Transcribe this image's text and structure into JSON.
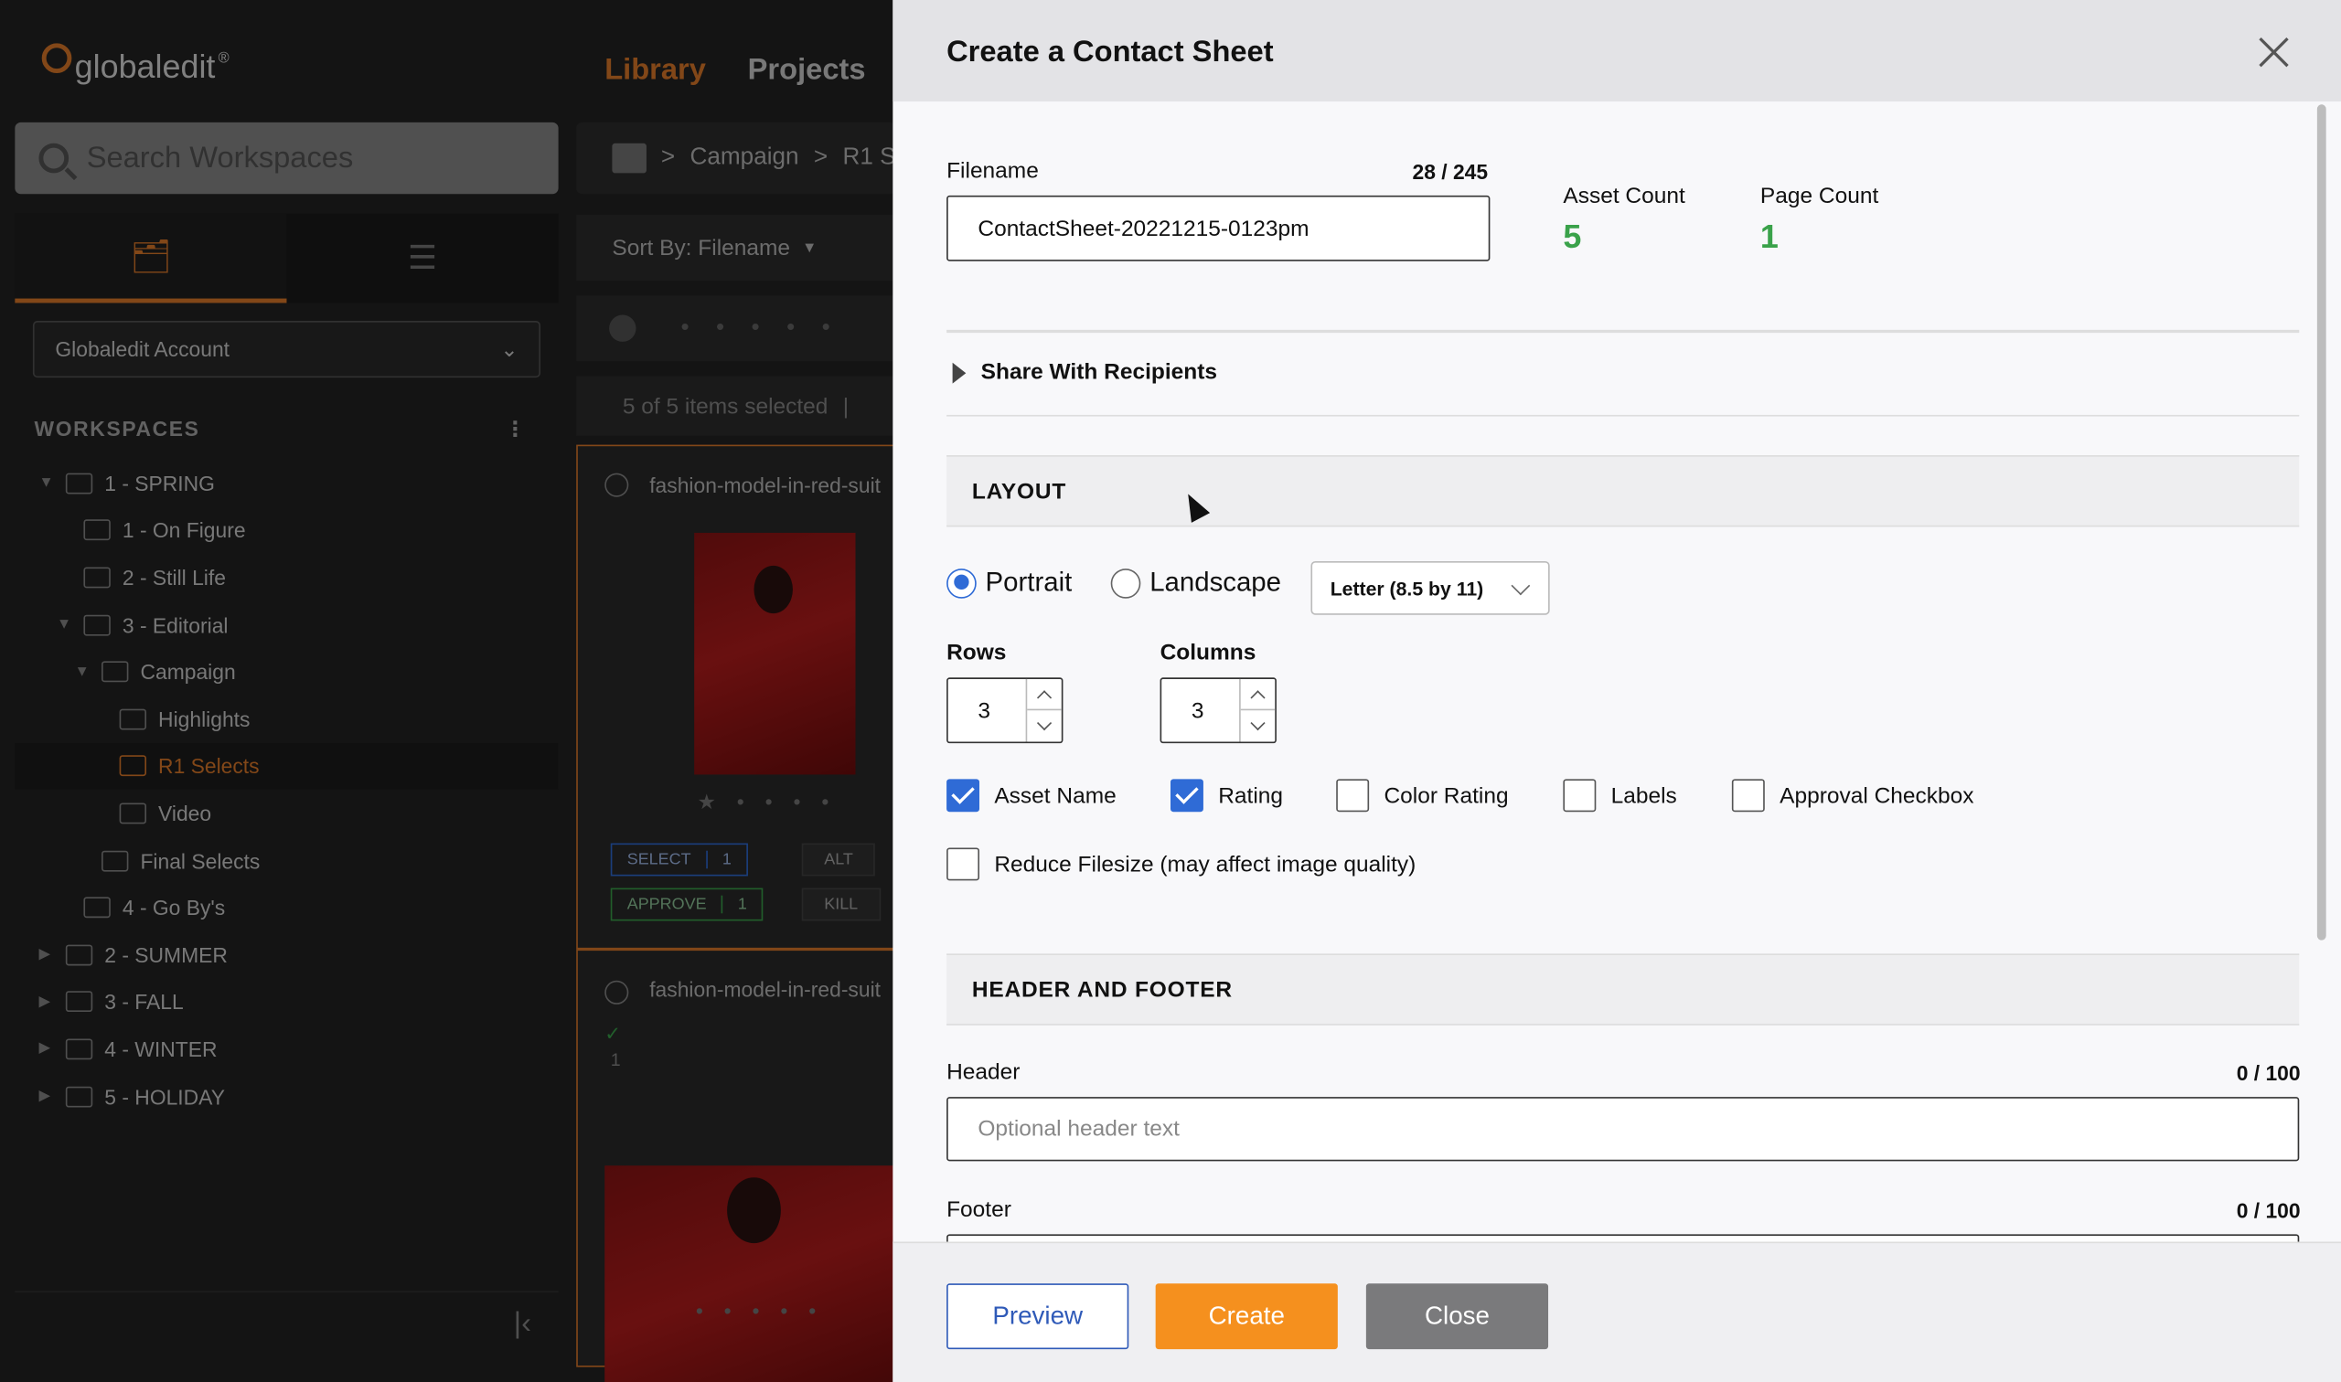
{
  "app": {
    "brand": "globaledit",
    "brand_mark": "®",
    "nav": {
      "library": "Library",
      "projects": "Projects"
    },
    "search_placeholder": "Search Workspaces",
    "account": "Globaledit Account",
    "workspaces_heading": "WORKSPACES",
    "tree": [
      {
        "label": "1 - SPRING",
        "level": 0,
        "expanded": true
      },
      {
        "label": "1 - On Figure",
        "level": 1
      },
      {
        "label": "2 - Still Life",
        "level": 1
      },
      {
        "label": "3 - Editorial",
        "level": 1,
        "expanded": true
      },
      {
        "label": "Campaign",
        "level": 2,
        "expanded": true
      },
      {
        "label": "Highlights",
        "level": 3
      },
      {
        "label": "R1 Selects",
        "level": 3,
        "selected": true
      },
      {
        "label": "Video",
        "level": 3
      },
      {
        "label": "Final Selects",
        "level": 2
      },
      {
        "label": "4 - Go By's",
        "level": 1
      },
      {
        "label": "2 - SUMMER",
        "level": 0
      },
      {
        "label": "3 - FALL",
        "level": 0
      },
      {
        "label": "4 - WINTER",
        "level": 0
      },
      {
        "label": "5 - HOLIDAY",
        "level": 0
      }
    ],
    "breadcrumb": {
      "sep": ">",
      "campaign": "Campaign",
      "current": "R1 S"
    },
    "sort_label": "Sort By: Filename",
    "selection_text": "5 of 5 items selected",
    "assets": [
      {
        "name": "fashion-model-in-red-suit"
      },
      {
        "name": "fashion-model-in-red-suit"
      }
    ],
    "asset_actions": {
      "select": "SELECT",
      "select_count": "1",
      "alt": "ALT",
      "approve": "APPROVE",
      "approve_count": "1",
      "kill": "KILL"
    },
    "asset2_badge": "1",
    "colors": {
      "accent": "#e07a2a",
      "selected_green": "#3aa24a"
    }
  },
  "modal": {
    "title": "Create a Contact Sheet",
    "filename_label": "Filename",
    "filename_counter": "28 / 245",
    "filename_value": "ContactSheet-20221215-0123pm",
    "asset_count_label": "Asset Count",
    "asset_count": "5",
    "page_count_label": "Page Count",
    "page_count": "1",
    "share_label": "Share With Recipients",
    "layout_heading": "LAYOUT",
    "orientation": {
      "portrait": "Portrait",
      "landscape": "Landscape",
      "selected": "portrait"
    },
    "paper_size": "Letter (8.5 by 11)",
    "rows_label": "Rows",
    "rows_value": "3",
    "columns_label": "Columns",
    "columns_value": "3",
    "options": {
      "asset_name": {
        "label": "Asset Name",
        "checked": true
      },
      "rating": {
        "label": "Rating",
        "checked": true
      },
      "color_rating": {
        "label": "Color Rating",
        "checked": false
      },
      "labels": {
        "label": "Labels",
        "checked": false
      },
      "approval_checkbox": {
        "label": "Approval Checkbox",
        "checked": false
      },
      "reduce_filesize": {
        "label": "Reduce Filesize (may affect image quality)",
        "checked": false
      }
    },
    "header_footer_heading": "HEADER AND FOOTER",
    "header_label": "Header",
    "header_counter": "0 / 100",
    "header_placeholder": "Optional header text",
    "footer_label": "Footer",
    "footer_counter": "0 / 100",
    "buttons": {
      "preview": "Preview",
      "create": "Create",
      "close": "Close"
    },
    "colors": {
      "primary_blue": "#2f6bd6",
      "create_orange": "#f5901e",
      "close_gray": "#7a7a7c"
    }
  }
}
